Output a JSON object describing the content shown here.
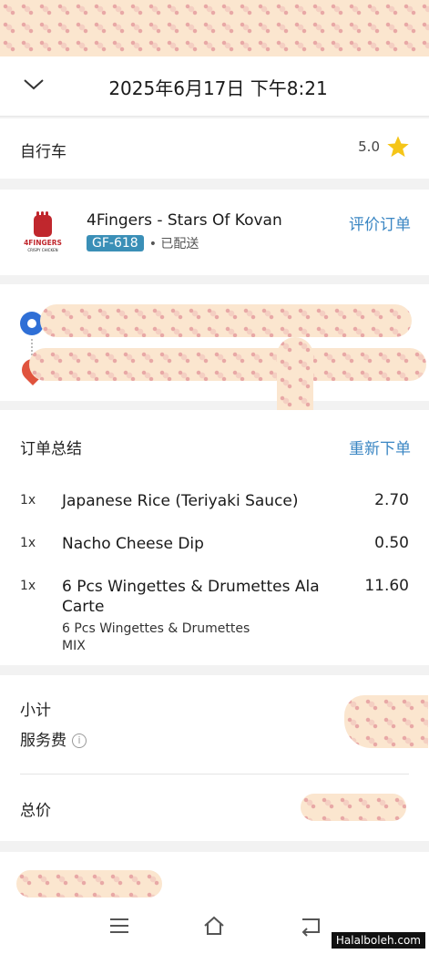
{
  "header": {
    "title": "2025年6月17日 下午8:21"
  },
  "vehicle": {
    "label": "自行车",
    "rating": "5.0"
  },
  "store": {
    "name": "4Fingers - Stars Of Kovan",
    "logo_text": "4FINGERS",
    "logo_sub": "CRISPY CHICKEN",
    "order_id": "GF-618",
    "status": "已配送",
    "rate_label": "评价订单"
  },
  "summary": {
    "title": "订单总结",
    "reorder_label": "重新下单",
    "items": [
      {
        "qty": "1x",
        "name": "Japanese Rice (Teriyaki Sauce)",
        "price": "2.70"
      },
      {
        "qty": "1x",
        "name": "Nacho Cheese Dip",
        "price": "0.50"
      },
      {
        "qty": "1x",
        "name": "6 Pcs Wingettes & Drumettes Ala Carte",
        "price": "11.60",
        "options": [
          "6 Pcs Wingettes & Drumettes",
          "MIX"
        ]
      }
    ]
  },
  "totals": {
    "subtotal_label": "小计",
    "service_fee_label": "服务费",
    "total_label": "总价"
  },
  "watermark": "Halalboleh.com",
  "colors": {
    "link": "#3a86c3",
    "badge": "#3a8fb7",
    "star": "#f5c518"
  }
}
